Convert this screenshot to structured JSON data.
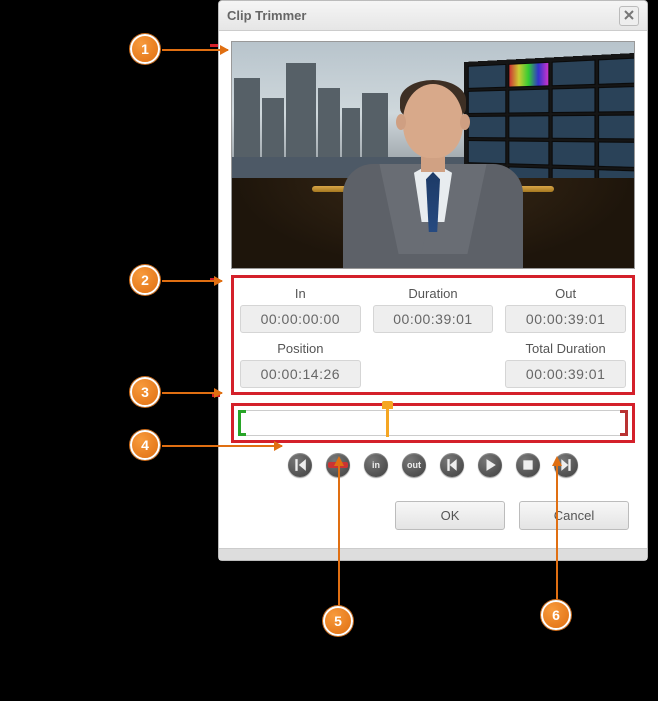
{
  "dialog": {
    "title": "Clip Trimmer",
    "ok": "OK",
    "cancel": "Cancel"
  },
  "timecode": {
    "in_label": "In",
    "duration_label": "Duration",
    "out_label": "Out",
    "position_label": "Position",
    "totaldur_label": "Total Duration",
    "in": "00:00:00:00",
    "duration": "00:00:39:01",
    "out": "00:00:39:01",
    "position": "00:00:14:26",
    "totaldur": "00:00:39:01"
  },
  "controls": {
    "in_text": "in",
    "out_text": "out"
  },
  "callouts": {
    "c1": "1",
    "c2": "2",
    "c3": "3",
    "c4": "4",
    "c5": "5",
    "c6": "6"
  }
}
